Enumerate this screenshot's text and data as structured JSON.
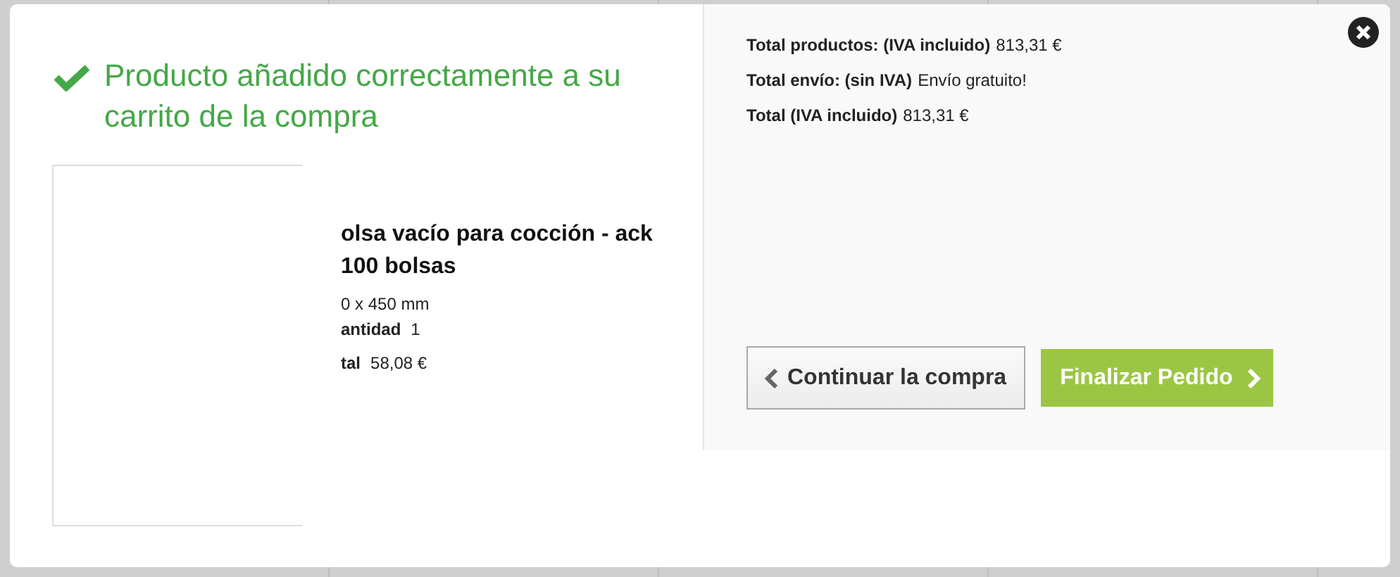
{
  "dialog": {
    "message": "Producto añadido correctamente a su carrito de la compra",
    "product": {
      "name": "olsa vacío para cocción - ack 100 bolsas",
      "size": "0 x 450 mm",
      "quantity_label": "antidad",
      "quantity": "1",
      "total_label": "tal",
      "total": "58,08 €"
    },
    "summary": [
      {
        "label": "Total productos: (IVA incluido)",
        "value": "813,31 €"
      },
      {
        "label": "Total envío: (sin IVA)",
        "value": "Envío gratuito!"
      },
      {
        "label": "Total (IVA incluido)",
        "value": "813,31 €"
      }
    ],
    "buttons": [
      {
        "label": "Continuar la compra",
        "kind": "secondary"
      },
      {
        "label": "Finalizar Pedido",
        "kind": "primary"
      }
    ]
  }
}
